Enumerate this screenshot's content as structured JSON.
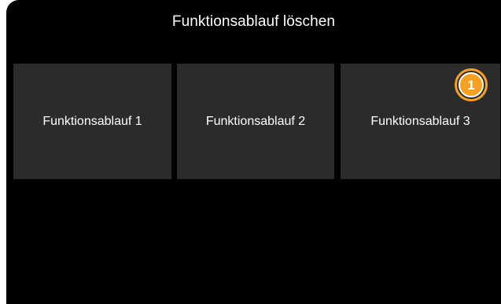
{
  "screen": {
    "title": "Funktionsablauf löschen"
  },
  "tiles": [
    {
      "label": "Funktionsablauf 1"
    },
    {
      "label": "Funktionsablauf 2"
    },
    {
      "label": "Funktionsablauf 3"
    }
  ],
  "callout": {
    "number": "1",
    "color": "#f5a021"
  }
}
